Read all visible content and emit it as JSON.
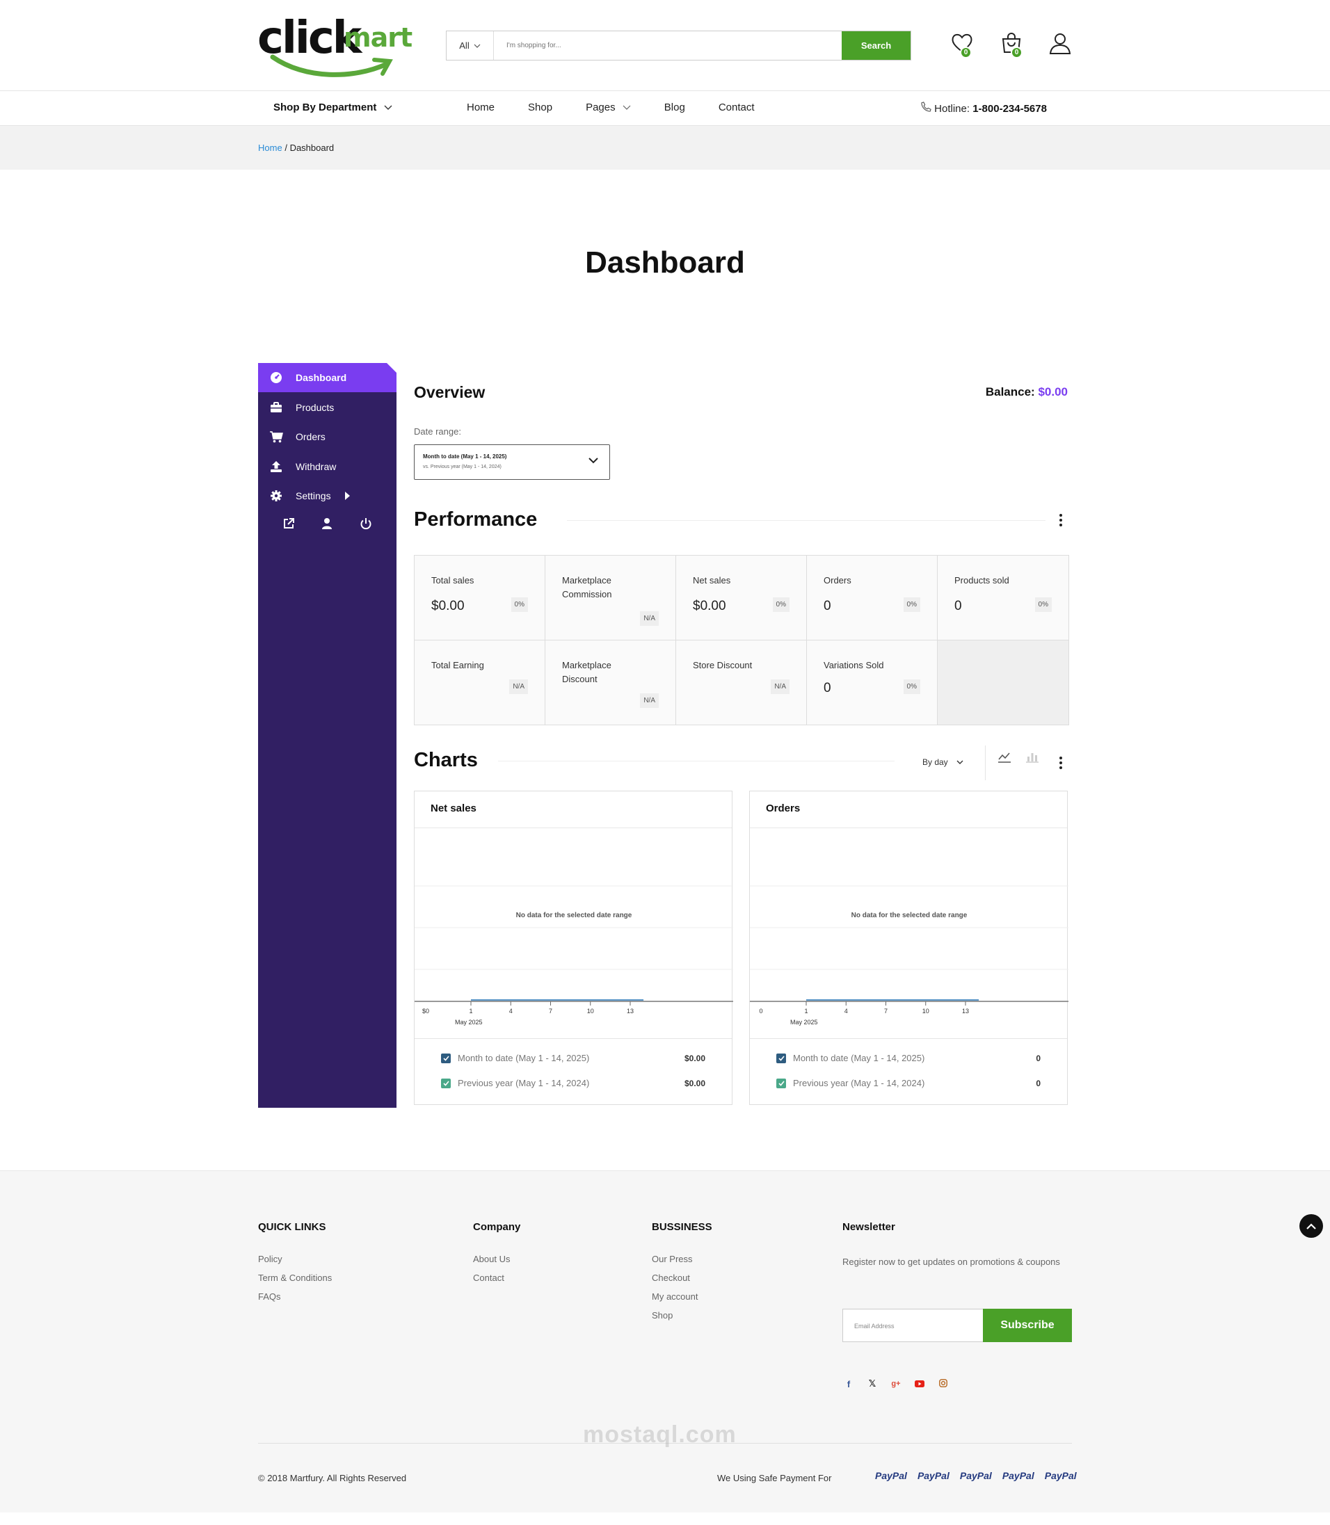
{
  "header": {
    "logo_primary": "click",
    "logo_secondary": "mart",
    "search_category": "All",
    "search_placeholder": "I'm shopping for...",
    "search_button": "Search",
    "wishlist_count": "0",
    "cart_count": "0"
  },
  "nav": {
    "department": "Shop By Department",
    "links": [
      "Home",
      "Shop",
      "Pages",
      "Blog",
      "Contact"
    ],
    "hotline_label": "Hotline:",
    "hotline_number": "1-800-234-5678"
  },
  "breadcrumb": {
    "home": "Home",
    "separator": "/",
    "current": "Dashboard"
  },
  "page_title": "Dashboard",
  "sidebar": {
    "items": [
      {
        "label": "Dashboard",
        "icon": "dashboard-icon"
      },
      {
        "label": "Products",
        "icon": "briefcase-icon"
      },
      {
        "label": "Orders",
        "icon": "cart-icon"
      },
      {
        "label": "Withdraw",
        "icon": "upload-icon"
      },
      {
        "label": "Settings",
        "icon": "gear-icon"
      }
    ],
    "bottom_icons": [
      "external-link-icon",
      "user-icon",
      "power-icon"
    ]
  },
  "overview": {
    "title": "Overview",
    "balance_label": "Balance:",
    "balance_value": "$0.00",
    "date_range_label": "Date range:",
    "date_range_primary": "Month to date (May 1 - 14, 2025)",
    "date_range_compare": "vs. Previous year (May 1 - 14, 2024)"
  },
  "performance": {
    "title": "Performance",
    "cells": [
      {
        "label": "Total sales",
        "value": "$0.00",
        "chip": "0%"
      },
      {
        "label": "Marketplace Commission",
        "value": "",
        "chip": "N/A"
      },
      {
        "label": "Net sales",
        "value": "$0.00",
        "chip": "0%"
      },
      {
        "label": "Orders",
        "value": "0",
        "chip": "0%"
      },
      {
        "label": "Products sold",
        "value": "0",
        "chip": "0%"
      },
      {
        "label": "Total Earning",
        "value": "",
        "chip": "N/A"
      },
      {
        "label": "Marketplace Discount",
        "value": "",
        "chip": "N/A"
      },
      {
        "label": "Store Discount",
        "value": "",
        "chip": "N/A"
      },
      {
        "label": "Variations Sold",
        "value": "0",
        "chip": "0%"
      }
    ]
  },
  "charts": {
    "title": "Charts",
    "interval": "By day",
    "no_data": "No data for the selected date range",
    "month_label": "May 2025",
    "accent": "#1f6fb0",
    "legend_primary_color": "#2e5c80",
    "legend_secondary_color": "#4aa889"
  },
  "chart_data": [
    {
      "type": "line",
      "title": "Net sales",
      "x": [
        "1",
        "4",
        "7",
        "10",
        "13"
      ],
      "series": [
        {
          "name": "Month to date (May 1 - 14, 2025)",
          "total": "$0.00",
          "values": [
            0,
            0,
            0,
            0,
            0
          ]
        },
        {
          "name": "Previous year (May 1 - 14, 2024)",
          "total": "$0.00",
          "values": [
            0,
            0,
            0,
            0,
            0
          ]
        }
      ],
      "y_tick": "$0",
      "xlabel": "May 2025"
    },
    {
      "type": "line",
      "title": "Orders",
      "x": [
        "1",
        "4",
        "7",
        "10",
        "13"
      ],
      "series": [
        {
          "name": "Month to date (May 1 - 14, 2025)",
          "total": "0",
          "values": [
            0,
            0,
            0,
            0,
            0
          ]
        },
        {
          "name": "Previous year (May 1 - 14, 2024)",
          "total": "0",
          "values": [
            0,
            0,
            0,
            0,
            0
          ]
        }
      ],
      "y_tick": "0",
      "xlabel": "May 2025"
    }
  ],
  "footer": {
    "quick_links": {
      "title": "QUICK LINKS",
      "items": [
        "Policy",
        "Term & Conditions",
        "FAQs"
      ]
    },
    "company": {
      "title": "Company",
      "items": [
        "About Us",
        "Contact"
      ]
    },
    "business": {
      "title": "BUSSINESS",
      "items": [
        "Our Press",
        "Checkout",
        "My account",
        "Shop"
      ]
    },
    "newsletter": {
      "title": "Newsletter",
      "text": "Register now to get updates on promotions & coupons",
      "placeholder": "Email Address",
      "button": "Subscribe"
    },
    "socials": [
      "facebook-icon",
      "x-icon",
      "google-plus-icon",
      "youtube-icon",
      "instagram-icon"
    ],
    "copyright": "© 2018 Martfury. All Rights Reserved",
    "payment_text": "We Using Safe Payment For",
    "payment_logo_text": "PayPal",
    "watermark": "mostaql.com"
  }
}
